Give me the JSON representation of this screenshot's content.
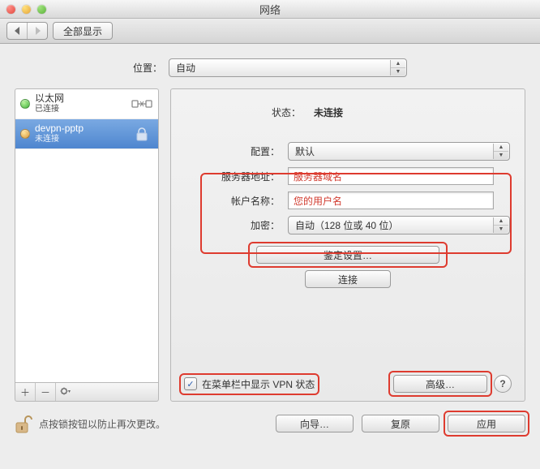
{
  "window": {
    "title": "网络"
  },
  "toolbar": {
    "show_all": "全部显示"
  },
  "location": {
    "label": "位置：",
    "value": "自动"
  },
  "sidebar": {
    "items": [
      {
        "name": "以太网",
        "status": "已连接",
        "dot": "green",
        "icon": "ethernet"
      },
      {
        "name": "devpn-pptp",
        "status": "未连接",
        "dot": "amber",
        "icon": "lock"
      }
    ]
  },
  "detail": {
    "status_label": "状态：",
    "status_value": "未连接",
    "config_label": "配置：",
    "config_value": "默认",
    "server_label": "服务器地址：",
    "server_value": "服务器域名",
    "account_label": "帐户名称：",
    "account_value": "您的用户名",
    "encrypt_label": "加密：",
    "encrypt_value": "自动（128 位或 40 位）",
    "auth_btn": "鉴定设置…",
    "connect_btn": "连接",
    "menubar_checkbox": "在菜单栏中显示 VPN 状态",
    "advanced_btn": "高级…"
  },
  "footer": {
    "lock_text": "点按锁按钮以防止再次更改。",
    "assist_btn": "向导…",
    "revert_btn": "复原",
    "apply_btn": "应用"
  }
}
